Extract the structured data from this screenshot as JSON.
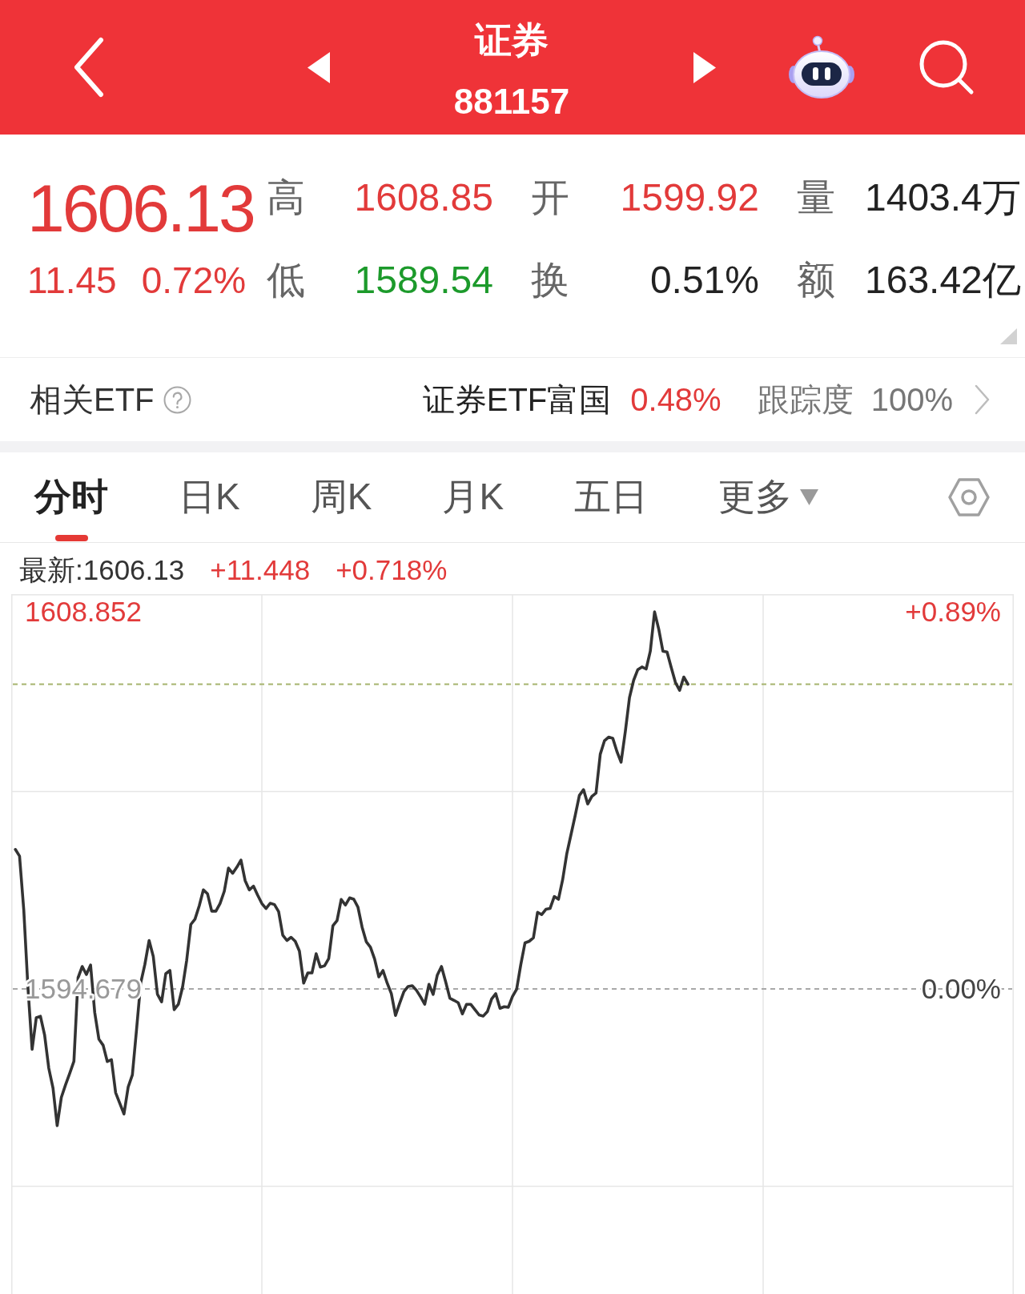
{
  "header": {
    "title": "证券",
    "code": "881157"
  },
  "quote": {
    "price": "1606.13",
    "change": "11.45",
    "change_pct": "0.72%",
    "color": "#e23a3a",
    "stats": [
      {
        "label": "高",
        "value": "1608.85",
        "color": "#e23a3a"
      },
      {
        "label": "开",
        "value": "1599.92",
        "color": "#e23a3a"
      },
      {
        "label": "量",
        "value": "1403.4万",
        "color": "#222222"
      },
      {
        "label": "低",
        "value": "1589.54",
        "color": "#1c9a2b"
      },
      {
        "label": "换",
        "value": "0.51%",
        "color": "#222222"
      },
      {
        "label": "额",
        "value": "163.42亿",
        "color": "#222222"
      }
    ]
  },
  "related_etf": {
    "label": "相关ETF",
    "name": "证券ETF富国",
    "change": "0.48%",
    "color": "#e23a3a",
    "tracking_label": "跟踪度",
    "tracking": "100%"
  },
  "tabs": [
    {
      "label": "分时",
      "kind": "tab",
      "selected": true
    },
    {
      "label": "日K",
      "kind": "tab",
      "selected": false
    },
    {
      "label": "周K",
      "kind": "tab",
      "selected": false
    },
    {
      "label": "月K",
      "kind": "tab",
      "selected": false
    },
    {
      "label": "五日",
      "kind": "tab",
      "selected": false
    },
    {
      "label": "更多",
      "kind": "menu",
      "selected": false
    }
  ],
  "chart": {
    "latest": "最新:1606.13",
    "change": "+11.448",
    "change_pct": "+0.718%",
    "color": "#e23a3a",
    "price_labels": [
      {
        "color": "#e23a3a"
      },
      {
        "color": "#999999"
      }
    ],
    "percent_labels": [
      {
        "text": "+0.89%",
        "color": "#e23a3a"
      },
      {
        "text": "0.00%",
        "color": "#444444"
      }
    ],
    "chart_data": {
      "type": "line",
      "categories": [
        null,
        null,
        null,
        null,
        null,
        null,
        null,
        null,
        null,
        null,
        null,
        null,
        null,
        null,
        null,
        null,
        null,
        null,
        null,
        null,
        null,
        null,
        null,
        null,
        null,
        null,
        null,
        null,
        null,
        null,
        null,
        null,
        null,
        null,
        null,
        null,
        null,
        null,
        null,
        null,
        null,
        null,
        null,
        null,
        null,
        null,
        null,
        null,
        null,
        null,
        null,
        null,
        null,
        null,
        null,
        null,
        null,
        null,
        null,
        null,
        null,
        null,
        null,
        null,
        null,
        null,
        null,
        null,
        null,
        null,
        null,
        null,
        null,
        null,
        null,
        null,
        null,
        null,
        null,
        null,
        null,
        null,
        null,
        null,
        null,
        null,
        null,
        null,
        null,
        null,
        null,
        null,
        null,
        null,
        null,
        null,
        null,
        null,
        null,
        null,
        null,
        null,
        null,
        null,
        null,
        null,
        null,
        null,
        null,
        null,
        null,
        null,
        null,
        null,
        null,
        null,
        null,
        null,
        null,
        null,
        null,
        null,
        null,
        null,
        null,
        null,
        null,
        null,
        null,
        null,
        null,
        null,
        null,
        null,
        null,
        null,
        null,
        null,
        null,
        null,
        null,
        null,
        null,
        null,
        null,
        null,
        null,
        null,
        null,
        null,
        null,
        null,
        null,
        null,
        null,
        null,
        null,
        null,
        null,
        null,
        null,
        null,
        null,
        null,
        null,
        null,
        null,
        null,
        null,
        null,
        null,
        null,
        null,
        null,
        null,
        null,
        null,
        null,
        null,
        null,
        null,
        null,
        null,
        null,
        null,
        null,
        null,
        null,
        null,
        null,
        null,
        null,
        null,
        null,
        null,
        null,
        null,
        null,
        null,
        null,
        null,
        null,
        null,
        null,
        null,
        null,
        null,
        null,
        null,
        null,
        null,
        null,
        null,
        null,
        null,
        null,
        null,
        null,
        null,
        null,
        null,
        null,
        null,
        null,
        null,
        null,
        null,
        null,
        null,
        null,
        null,
        null,
        null,
        null,
        null,
        null,
        null,
        null,
        null,
        null
      ],
      "series": [
        {
          "color": "#333333",
          "values": [
            1599.92,
            1599.67,
            1597.64,
            1594.73,
            1592.41,
            1593.6,
            1593.65,
            1592.95,
            1591.7,
            1590.95,
            1589.54,
            1590.6,
            1591.07,
            1591.5,
            1591.96,
            1595.1,
            1595.52,
            1595.22,
            1595.58,
            1593.79,
            1592.79,
            1592.56,
            1591.95,
            1592.02,
            1590.78,
            1590.38,
            1589.98,
            1591.0,
            1591.45,
            1593.15,
            1594.9,
            1595.6,
            1596.5,
            1595.9,
            1594.48,
            1594.19,
            1595.25,
            1595.37,
            1593.9,
            1594.1,
            1594.73,
            1595.75,
            1597.1,
            1597.3,
            1597.8,
            1598.4,
            1598.25,
            1597.6,
            1597.6,
            1597.89,
            1598.35,
            1599.22,
            1599.02,
            1599.25,
            1599.52,
            1598.75,
            1598.4,
            1598.54,
            1598.2,
            1597.89,
            1597.7,
            1597.9,
            1597.85,
            1597.59,
            1596.7,
            1596.5,
            1596.62,
            1596.47,
            1596.1,
            1594.9,
            1595.28,
            1595.28,
            1596.0,
            1595.5,
            1595.55,
            1595.82,
            1597.05,
            1597.25,
            1598.04,
            1597.83,
            1598.1,
            1598.05,
            1597.75,
            1597.0,
            1596.45,
            1596.25,
            1595.8,
            1595.13,
            1595.37,
            1594.9,
            1594.5,
            1593.68,
            1594.15,
            1594.58,
            1594.77,
            1594.8,
            1594.63,
            1594.38,
            1594.1,
            1594.85,
            1594.47,
            1595.2,
            1595.52,
            1594.95,
            1594.33,
            1594.25,
            1594.16,
            1593.74,
            1594.1,
            1594.1,
            1593.9,
            1593.7,
            1593.66,
            1593.83,
            1594.3,
            1594.5,
            1593.95,
            1594.01,
            1593.99,
            1594.4,
            1594.67,
            1595.6,
            1596.41,
            1596.47,
            1596.6,
            1597.56,
            1597.47,
            1597.67,
            1597.7,
            1598.15,
            1598.05,
            1598.78,
            1599.76,
            1600.47,
            1601.2,
            1601.95,
            1602.17,
            1601.63,
            1601.91,
            1602.04,
            1603.5,
            1604.0,
            1604.14,
            1604.1,
            1603.6,
            1603.2,
            1604.35,
            1605.63,
            1606.28,
            1606.68,
            1606.78,
            1606.7,
            1607.37,
            1608.85,
            1608.2,
            1607.37,
            1607.34,
            1606.76,
            1606.2,
            1605.9,
            1606.4,
            1606.13,
            null,
            null,
            null,
            null,
            null,
            null,
            null,
            null,
            null,
            null,
            null,
            null,
            null,
            null,
            null,
            null,
            null,
            null,
            null,
            null,
            null,
            null,
            null,
            null,
            null,
            null,
            null,
            null,
            null,
            null,
            null,
            null,
            null,
            null,
            null,
            null,
            null,
            null,
            null,
            null,
            null,
            null,
            null,
            null,
            null,
            null,
            null,
            null,
            null,
            null,
            null,
            null,
            null,
            null,
            null,
            null,
            null,
            null,
            null,
            null,
            null,
            null,
            null,
            null,
            null,
            null,
            null,
            null,
            null,
            null,
            null,
            null,
            null,
            null,
            null,
            null,
            null,
            null
          ]
        }
      ],
      "ylim": [
        1583.214,
        1609.514
      ],
      "yticks": [
        {
          "value": 1608.852,
          "label": "1608.852"
        },
        {
          "value": 1594.679,
          "label": "1594.679"
        }
      ],
      "ref_lines": [
        {
          "axis": "y",
          "value": 1594.679,
          "color": "#a8a8a8"
        },
        {
          "axis": "y",
          "value": 1606.13,
          "color": "#a6b46e"
        }
      ]
    }
  }
}
